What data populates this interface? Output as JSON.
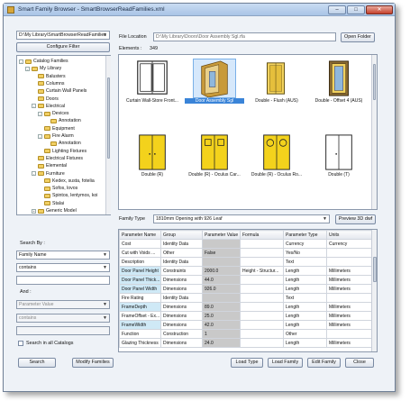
{
  "window": {
    "title": "Smart Family Browser - SmartBrowserReadFamilies.xml",
    "minimize": "–",
    "maximize": "□",
    "close": "✕"
  },
  "left": {
    "path_combo": "D:\\My Library\\SmartBrowserReadFamilies",
    "configure_filter": "Configure Filter",
    "tree": [
      {
        "label": "Catalog Families",
        "depth": 0,
        "expander": "-"
      },
      {
        "label": "My Library",
        "depth": 1,
        "expander": "-"
      },
      {
        "label": "Balusters",
        "depth": 2,
        "expander": ""
      },
      {
        "label": "Columns",
        "depth": 2,
        "expander": ""
      },
      {
        "label": "Curtain Wall Panels",
        "depth": 2,
        "expander": ""
      },
      {
        "label": "Doors",
        "depth": 2,
        "expander": ""
      },
      {
        "label": "Electrical",
        "depth": 2,
        "expander": "-"
      },
      {
        "label": "Devices",
        "depth": 3,
        "expander": "-"
      },
      {
        "label": "Annotation",
        "depth": 4,
        "expander": ""
      },
      {
        "label": "Equipment",
        "depth": 3,
        "expander": ""
      },
      {
        "label": "Fire Alarm",
        "depth": 3,
        "expander": "-"
      },
      {
        "label": "Annotation",
        "depth": 4,
        "expander": ""
      },
      {
        "label": "Lighting Fixtures",
        "depth": 3,
        "expander": ""
      },
      {
        "label": "Electrical Fixtures",
        "depth": 2,
        "expander": ""
      },
      {
        "label": "Elemental",
        "depth": 2,
        "expander": ""
      },
      {
        "label": "Furniture",
        "depth": 2,
        "expander": "-"
      },
      {
        "label": "Kedex, susta, fotelia",
        "depth": 3,
        "expander": ""
      },
      {
        "label": "Sofos, lovos",
        "depth": 3,
        "expander": ""
      },
      {
        "label": "Spintos, lentymos, koi",
        "depth": 3,
        "expander": ""
      },
      {
        "label": "Stalai",
        "depth": 3,
        "expander": ""
      },
      {
        "label": "Generic Model",
        "depth": 2,
        "expander": "+"
      }
    ],
    "search_by_label": "Search By :",
    "search_field": "Family Name",
    "search_op": "contains",
    "and_label": "And :",
    "param_value": "Parameter Value",
    "param_op": "contains",
    "search_all_catalogs": "Search in all Catalogs",
    "search_button": "Search",
    "modify_families_button": "Modify Families"
  },
  "right": {
    "file_location_label": "File Location",
    "file_location_value": "D:\\My Library\\Doors\\Door Assembly Sgl.rfa",
    "open_folder": "Open Folder",
    "elements_label": "Elements :",
    "elements_count": "349",
    "thumbnails": [
      {
        "caption": "Curtain Wall-Store Front...",
        "kind": "white-double-glass",
        "selected": false
      },
      {
        "caption": "Door Assembly Sgl",
        "kind": "assembly",
        "selected": true
      },
      {
        "caption": "Double - Flush (AUS)",
        "kind": "flush",
        "selected": false
      },
      {
        "caption": "Double - Offset 4 (AUS)",
        "kind": "offset",
        "selected": false
      },
      {
        "caption": "Double (R)",
        "kind": "yellow-double",
        "selected": false
      },
      {
        "caption": "Double (R) - Oculus Car...",
        "kind": "yellow-square",
        "selected": false
      },
      {
        "caption": "Double (R) - Oculus Ro...",
        "kind": "yellow-round",
        "selected": false
      },
      {
        "caption": "Double (T)",
        "kind": "white-double",
        "selected": false
      }
    ],
    "family_type_label": "Family Type",
    "family_type_value": "1810mm Opening with 926 Leaf",
    "preview_3d": "Preview 3D dwf",
    "table_headers": [
      "Parameter Name",
      "Group",
      "Parameter Value",
      "Formula",
      "Parameter Type",
      "Units"
    ],
    "table_rows": [
      {
        "name": "Cost",
        "group": "Identity Data",
        "value": "",
        "formula": "",
        "ptype": "Currency",
        "units": "Currency",
        "hl": false
      },
      {
        "name": "Cut with Voids ...",
        "group": "Other",
        "value": "False",
        "formula": "",
        "ptype": "Yes/No",
        "units": "",
        "hl": false
      },
      {
        "name": "Description",
        "group": "Identity Data",
        "value": "",
        "formula": "",
        "ptype": "Text",
        "units": "",
        "hl": false
      },
      {
        "name": "Door Panel Height",
        "group": "Constraints",
        "value": "2000.0",
        "formula": "Height - Structur...",
        "ptype": "Length",
        "units": "Millimeters",
        "hl": true
      },
      {
        "name": "Door Panel Thick...",
        "group": "Dimensions",
        "value": "44.0",
        "formula": "",
        "ptype": "Length",
        "units": "Millimeters",
        "hl": true
      },
      {
        "name": "Door Panel Width",
        "group": "Dimensions",
        "value": "926.0",
        "formula": "",
        "ptype": "Length",
        "units": "Millimeters",
        "hl": true
      },
      {
        "name": "Fire Rating",
        "group": "Identity Data",
        "value": "",
        "formula": "",
        "ptype": "Text",
        "units": "",
        "hl": false
      },
      {
        "name": "FrameDepth",
        "group": "Dimensions",
        "value": "89.0",
        "formula": "",
        "ptype": "Length",
        "units": "Millimeters",
        "hl": true
      },
      {
        "name": "FrameOffset - Ex...",
        "group": "Dimensions",
        "value": "25.0",
        "formula": "",
        "ptype": "Length",
        "units": "Millimeters",
        "hl": false
      },
      {
        "name": "FrameWidth",
        "group": "Dimensions",
        "value": "42.0",
        "formula": "",
        "ptype": "Length",
        "units": "Millimeters",
        "hl": true
      },
      {
        "name": "Function",
        "group": "Construction",
        "value": "1",
        "formula": "",
        "ptype": "Other",
        "units": "",
        "hl": false
      },
      {
        "name": "Glazing Thickness",
        "group": "Dimensions",
        "value": "24.0",
        "formula": "",
        "ptype": "Length",
        "units": "Millimeters",
        "hl": false
      }
    ],
    "load_type": "Load Type",
    "load_family": "Load Family",
    "edit_family": "Edit Family",
    "close": "Close"
  }
}
